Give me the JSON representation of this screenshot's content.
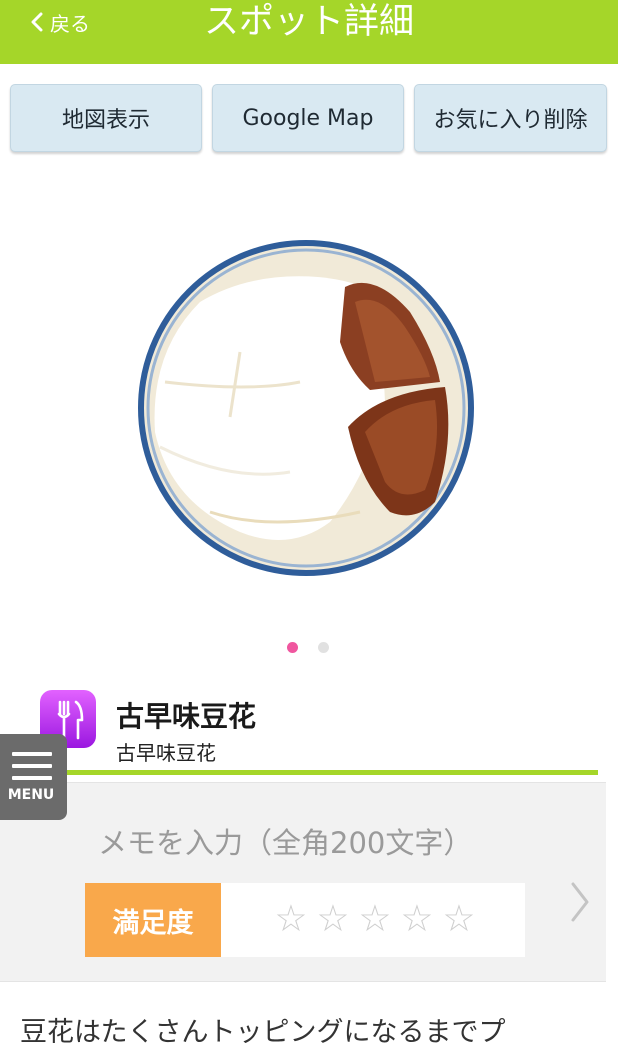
{
  "header": {
    "back_label": "戻る",
    "title": "スポット詳細"
  },
  "actions": {
    "map_label": "地図表示",
    "google_map_label": "Google Map",
    "favorite_remove_label": "お気に入り削除"
  },
  "carousel": {
    "total": 2,
    "active_index": 1
  },
  "spot": {
    "category_icon": "restaurant-fork-knife-icon",
    "category_color": "#c13ff2",
    "name": "古早味豆花",
    "subname": "古早味豆花"
  },
  "menu": {
    "label": "MENU",
    "icon": "hamburger-icon"
  },
  "memo": {
    "placeholder": "メモを入力（全角200文字）"
  },
  "rating": {
    "label": "満足度",
    "stars": [
      "☆",
      "☆",
      "☆",
      "☆",
      "☆"
    ],
    "value": 0,
    "max": 5
  },
  "description": {
    "text": "豆花はたくさんトッピングになるまでプ"
  },
  "colors": {
    "accent_green": "#a5d629",
    "button_bg": "#d9e9f2",
    "rating_orange": "#f9a84b",
    "dot_active": "#f0569f"
  }
}
